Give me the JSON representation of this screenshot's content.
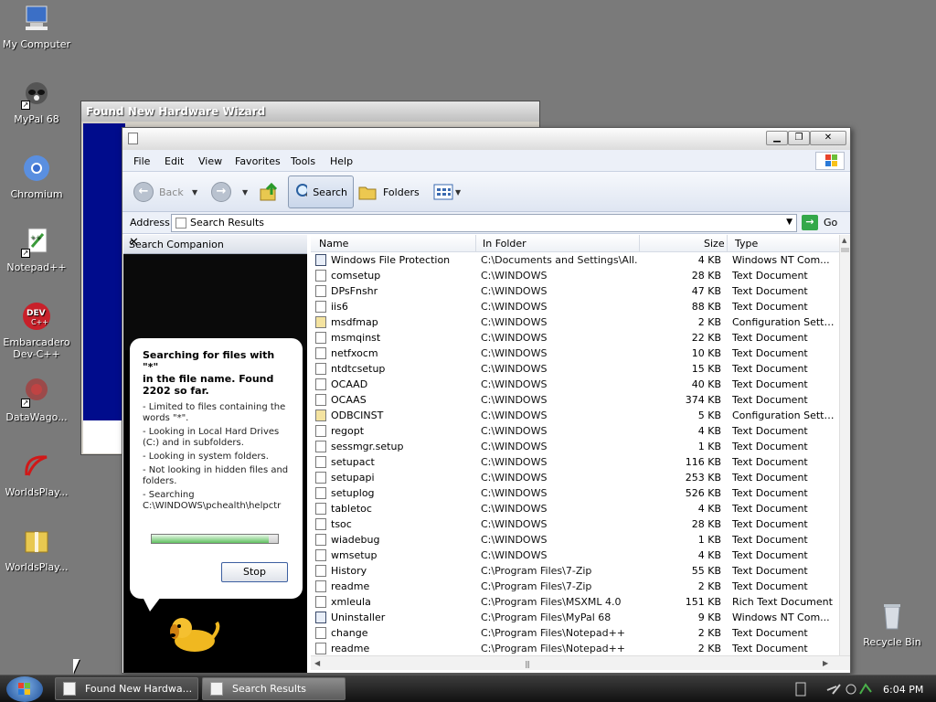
{
  "desktop": {
    "icons": [
      {
        "label": "My Computer",
        "icon": "computer-icon"
      },
      {
        "label": "MyPal 68",
        "icon": "raccoon-icon"
      },
      {
        "label": "Chromium",
        "icon": "chromium-icon"
      },
      {
        "label": "Notepad++",
        "icon": "notepadpp-icon"
      },
      {
        "label": "Embarcadero Dev-C++",
        "icon": "devcpp-icon"
      },
      {
        "label": "DataWago...",
        "icon": "datawagon-icon"
      },
      {
        "label": "WorldsPlay...",
        "icon": "worldsplayer-icon"
      },
      {
        "label": "WorldsPlay...",
        "icon": "zip-folder-icon"
      }
    ],
    "recycle_bin_label": "Recycle Bin"
  },
  "wizard": {
    "title": "Found New Hardware Wizard"
  },
  "explorer": {
    "menu": [
      "File",
      "Edit",
      "View",
      "Favorites",
      "Tools",
      "Help"
    ],
    "toolbar": {
      "back": "Back",
      "search": "Search",
      "folders": "Folders"
    },
    "address": {
      "label": "Address",
      "value": "Search Results",
      "go": "Go"
    }
  },
  "companion": {
    "title": "Search Companion",
    "status": "Searching for files with \"*\"\nin the file name.  Found\n2202 so far.",
    "bullets": [
      "- Limited to files containing the words \"*\".",
      "- Looking in Local Hard Drives (C:) and in subfolders.",
      "- Looking in system folders.",
      "- Not looking in hidden files and folders.",
      "- Searching C:\\WINDOWS\\pchealth\\helpctr"
    ],
    "progress": 0.93,
    "stop": "Stop"
  },
  "results": {
    "columns": [
      "Name",
      "In Folder",
      "Size",
      "Type"
    ],
    "rows": [
      {
        "name": "Windows File Protection",
        "folder": "C:\\Documents and Settings\\All...",
        "size": "4 KB",
        "type": "Windows NT Com...",
        "kind": "app"
      },
      {
        "name": "comsetup",
        "folder": "C:\\WINDOWS",
        "size": "28 KB",
        "type": "Text Document",
        "kind": "txt"
      },
      {
        "name": "DPsFnshr",
        "folder": "C:\\WINDOWS",
        "size": "47 KB",
        "type": "Text Document",
        "kind": "txt"
      },
      {
        "name": "iis6",
        "folder": "C:\\WINDOWS",
        "size": "88 KB",
        "type": "Text Document",
        "kind": "txt"
      },
      {
        "name": "msdfmap",
        "folder": "C:\\WINDOWS",
        "size": "2 KB",
        "type": "Configuration Setti...",
        "kind": "cfg"
      },
      {
        "name": "msmqinst",
        "folder": "C:\\WINDOWS",
        "size": "22 KB",
        "type": "Text Document",
        "kind": "txt"
      },
      {
        "name": "netfxocm",
        "folder": "C:\\WINDOWS",
        "size": "10 KB",
        "type": "Text Document",
        "kind": "txt"
      },
      {
        "name": "ntdtcsetup",
        "folder": "C:\\WINDOWS",
        "size": "15 KB",
        "type": "Text Document",
        "kind": "txt"
      },
      {
        "name": "OCAAD",
        "folder": "C:\\WINDOWS",
        "size": "40 KB",
        "type": "Text Document",
        "kind": "txt"
      },
      {
        "name": "OCAAS",
        "folder": "C:\\WINDOWS",
        "size": "374 KB",
        "type": "Text Document",
        "kind": "txt"
      },
      {
        "name": "ODBCINST",
        "folder": "C:\\WINDOWS",
        "size": "5 KB",
        "type": "Configuration Setti...",
        "kind": "cfg"
      },
      {
        "name": "regopt",
        "folder": "C:\\WINDOWS",
        "size": "4 KB",
        "type": "Text Document",
        "kind": "txt"
      },
      {
        "name": "sessmgr.setup",
        "folder": "C:\\WINDOWS",
        "size": "1 KB",
        "type": "Text Document",
        "kind": "txt"
      },
      {
        "name": "setupact",
        "folder": "C:\\WINDOWS",
        "size": "116 KB",
        "type": "Text Document",
        "kind": "txt"
      },
      {
        "name": "setupapi",
        "folder": "C:\\WINDOWS",
        "size": "253 KB",
        "type": "Text Document",
        "kind": "txt"
      },
      {
        "name": "setuplog",
        "folder": "C:\\WINDOWS",
        "size": "526 KB",
        "type": "Text Document",
        "kind": "txt"
      },
      {
        "name": "tabletoc",
        "folder": "C:\\WINDOWS",
        "size": "4 KB",
        "type": "Text Document",
        "kind": "txt"
      },
      {
        "name": "tsoc",
        "folder": "C:\\WINDOWS",
        "size": "28 KB",
        "type": "Text Document",
        "kind": "txt"
      },
      {
        "name": "wiadebug",
        "folder": "C:\\WINDOWS",
        "size": "1 KB",
        "type": "Text Document",
        "kind": "txt"
      },
      {
        "name": "wmsetup",
        "folder": "C:\\WINDOWS",
        "size": "4 KB",
        "type": "Text Document",
        "kind": "txt"
      },
      {
        "name": "History",
        "folder": "C:\\Program Files\\7-Zip",
        "size": "55 KB",
        "type": "Text Document",
        "kind": "txt"
      },
      {
        "name": "readme",
        "folder": "C:\\Program Files\\7-Zip",
        "size": "2 KB",
        "type": "Text Document",
        "kind": "txt"
      },
      {
        "name": "xmleula",
        "folder": "C:\\Program Files\\MSXML 4.0",
        "size": "151 KB",
        "type": "Rich Text Document",
        "kind": "rtf"
      },
      {
        "name": "Uninstaller",
        "folder": "C:\\Program Files\\MyPal 68",
        "size": "9 KB",
        "type": "Windows NT Com...",
        "kind": "app"
      },
      {
        "name": "change",
        "folder": "C:\\Program Files\\Notepad++",
        "size": "2 KB",
        "type": "Text Document",
        "kind": "txt"
      },
      {
        "name": "readme",
        "folder": "C:\\Program Files\\Notepad++",
        "size": "2 KB",
        "type": "Text Document",
        "kind": "txt"
      }
    ]
  },
  "taskbar": {
    "tasks": [
      "Found New Hardwa...",
      "Search Results"
    ],
    "clock": "6:04 PM"
  }
}
